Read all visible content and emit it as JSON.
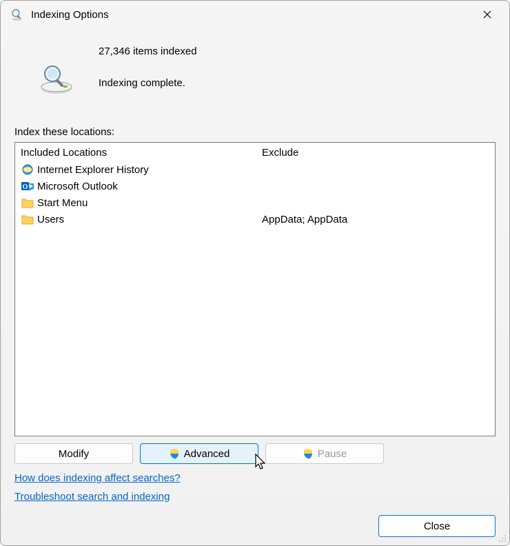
{
  "title": "Indexing Options",
  "status": {
    "count_line": "27,346 items indexed",
    "state_line": "Indexing complete."
  },
  "section_label": "Index these locations:",
  "columns": {
    "included_header": "Included Locations",
    "exclude_header": "Exclude"
  },
  "locations": [
    {
      "icon": "ie",
      "label": "Internet Explorer History",
      "exclude": ""
    },
    {
      "icon": "outlook",
      "label": "Microsoft Outlook",
      "exclude": ""
    },
    {
      "icon": "folder",
      "label": "Start Menu",
      "exclude": ""
    },
    {
      "icon": "folder",
      "label": "Users",
      "exclude": "AppData; AppData"
    }
  ],
  "buttons": {
    "modify": "Modify",
    "advanced": "Advanced",
    "pause": "Pause",
    "close": "Close"
  },
  "links": {
    "how": "How does indexing affect searches?",
    "troubleshoot": "Troubleshoot search and indexing"
  }
}
